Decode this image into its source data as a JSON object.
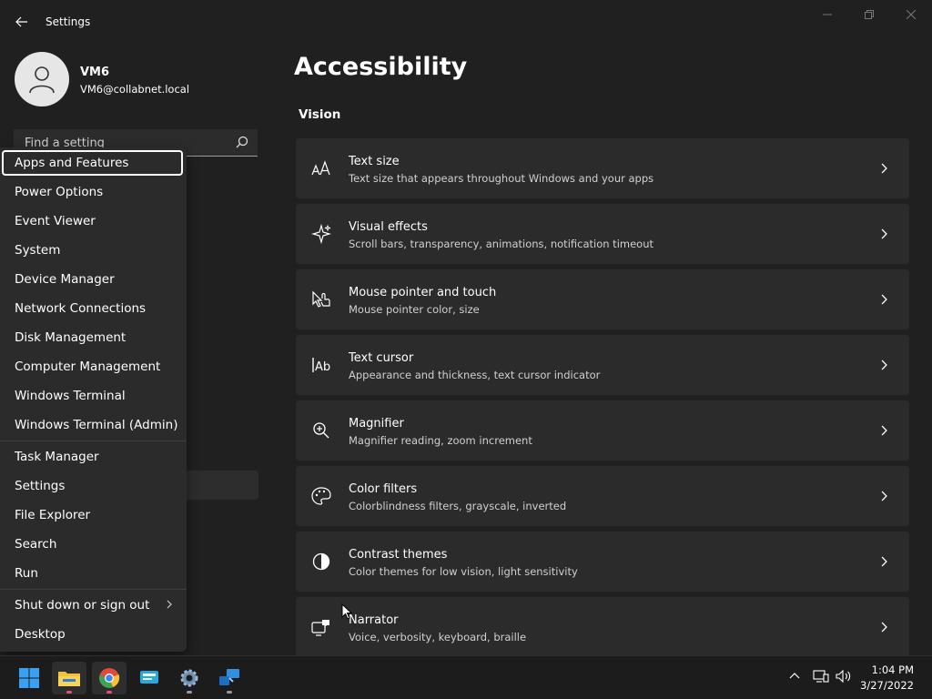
{
  "window": {
    "title": "Settings"
  },
  "user": {
    "name": "VM6",
    "email": "VM6@collabnet.local"
  },
  "search": {
    "placeholder": "Find a setting"
  },
  "page": {
    "title": "Accessibility",
    "section": "Vision"
  },
  "cards": [
    {
      "icon": "text-size-icon",
      "title": "Text size",
      "description": "Text size that appears throughout Windows and your apps"
    },
    {
      "icon": "sparkle-icon",
      "title": "Visual effects",
      "description": "Scroll bars, transparency, animations, notification timeout"
    },
    {
      "icon": "pointer-touch-icon",
      "title": "Mouse pointer and touch",
      "description": "Mouse pointer color, size"
    },
    {
      "icon": "text-cursor-icon",
      "title": "Text cursor",
      "description": "Appearance and thickness, text cursor indicator"
    },
    {
      "icon": "magnifier-icon",
      "title": "Magnifier",
      "description": "Magnifier reading, zoom increment"
    },
    {
      "icon": "palette-icon",
      "title": "Color filters",
      "description": "Colorblindness filters, grayscale, inverted"
    },
    {
      "icon": "contrast-icon",
      "title": "Contrast themes",
      "description": "Color themes for low vision, light sensitivity"
    },
    {
      "icon": "narrator-icon",
      "title": "Narrator",
      "description": "Voice, verbosity, keyboard, braille"
    }
  ],
  "context_menu": {
    "items": [
      "Apps and Features",
      "Power Options",
      "Event Viewer",
      "System",
      "Device Manager",
      "Network Connections",
      "Disk Management",
      "Computer Management",
      "Windows Terminal",
      "Windows Terminal (Admin)",
      "Task Manager",
      "Settings",
      "File Explorer",
      "Search",
      "Run",
      "Shut down or sign out",
      "Desktop"
    ],
    "focused_item": "Apps and Features"
  },
  "taskbar": {
    "apps": [
      "start-icon",
      "file-explorer-icon",
      "chrome-icon",
      "app-icon",
      "settings-gear-icon",
      "remote-app-icon"
    ],
    "clock": {
      "time": "1:04 PM",
      "date": "3/27/2022"
    }
  },
  "colors": {
    "background": "#202020",
    "card": "#2b2b2b",
    "menu": "#2b2b2b",
    "taskbar": "#1c1c1c",
    "accent": "#0078d4"
  }
}
